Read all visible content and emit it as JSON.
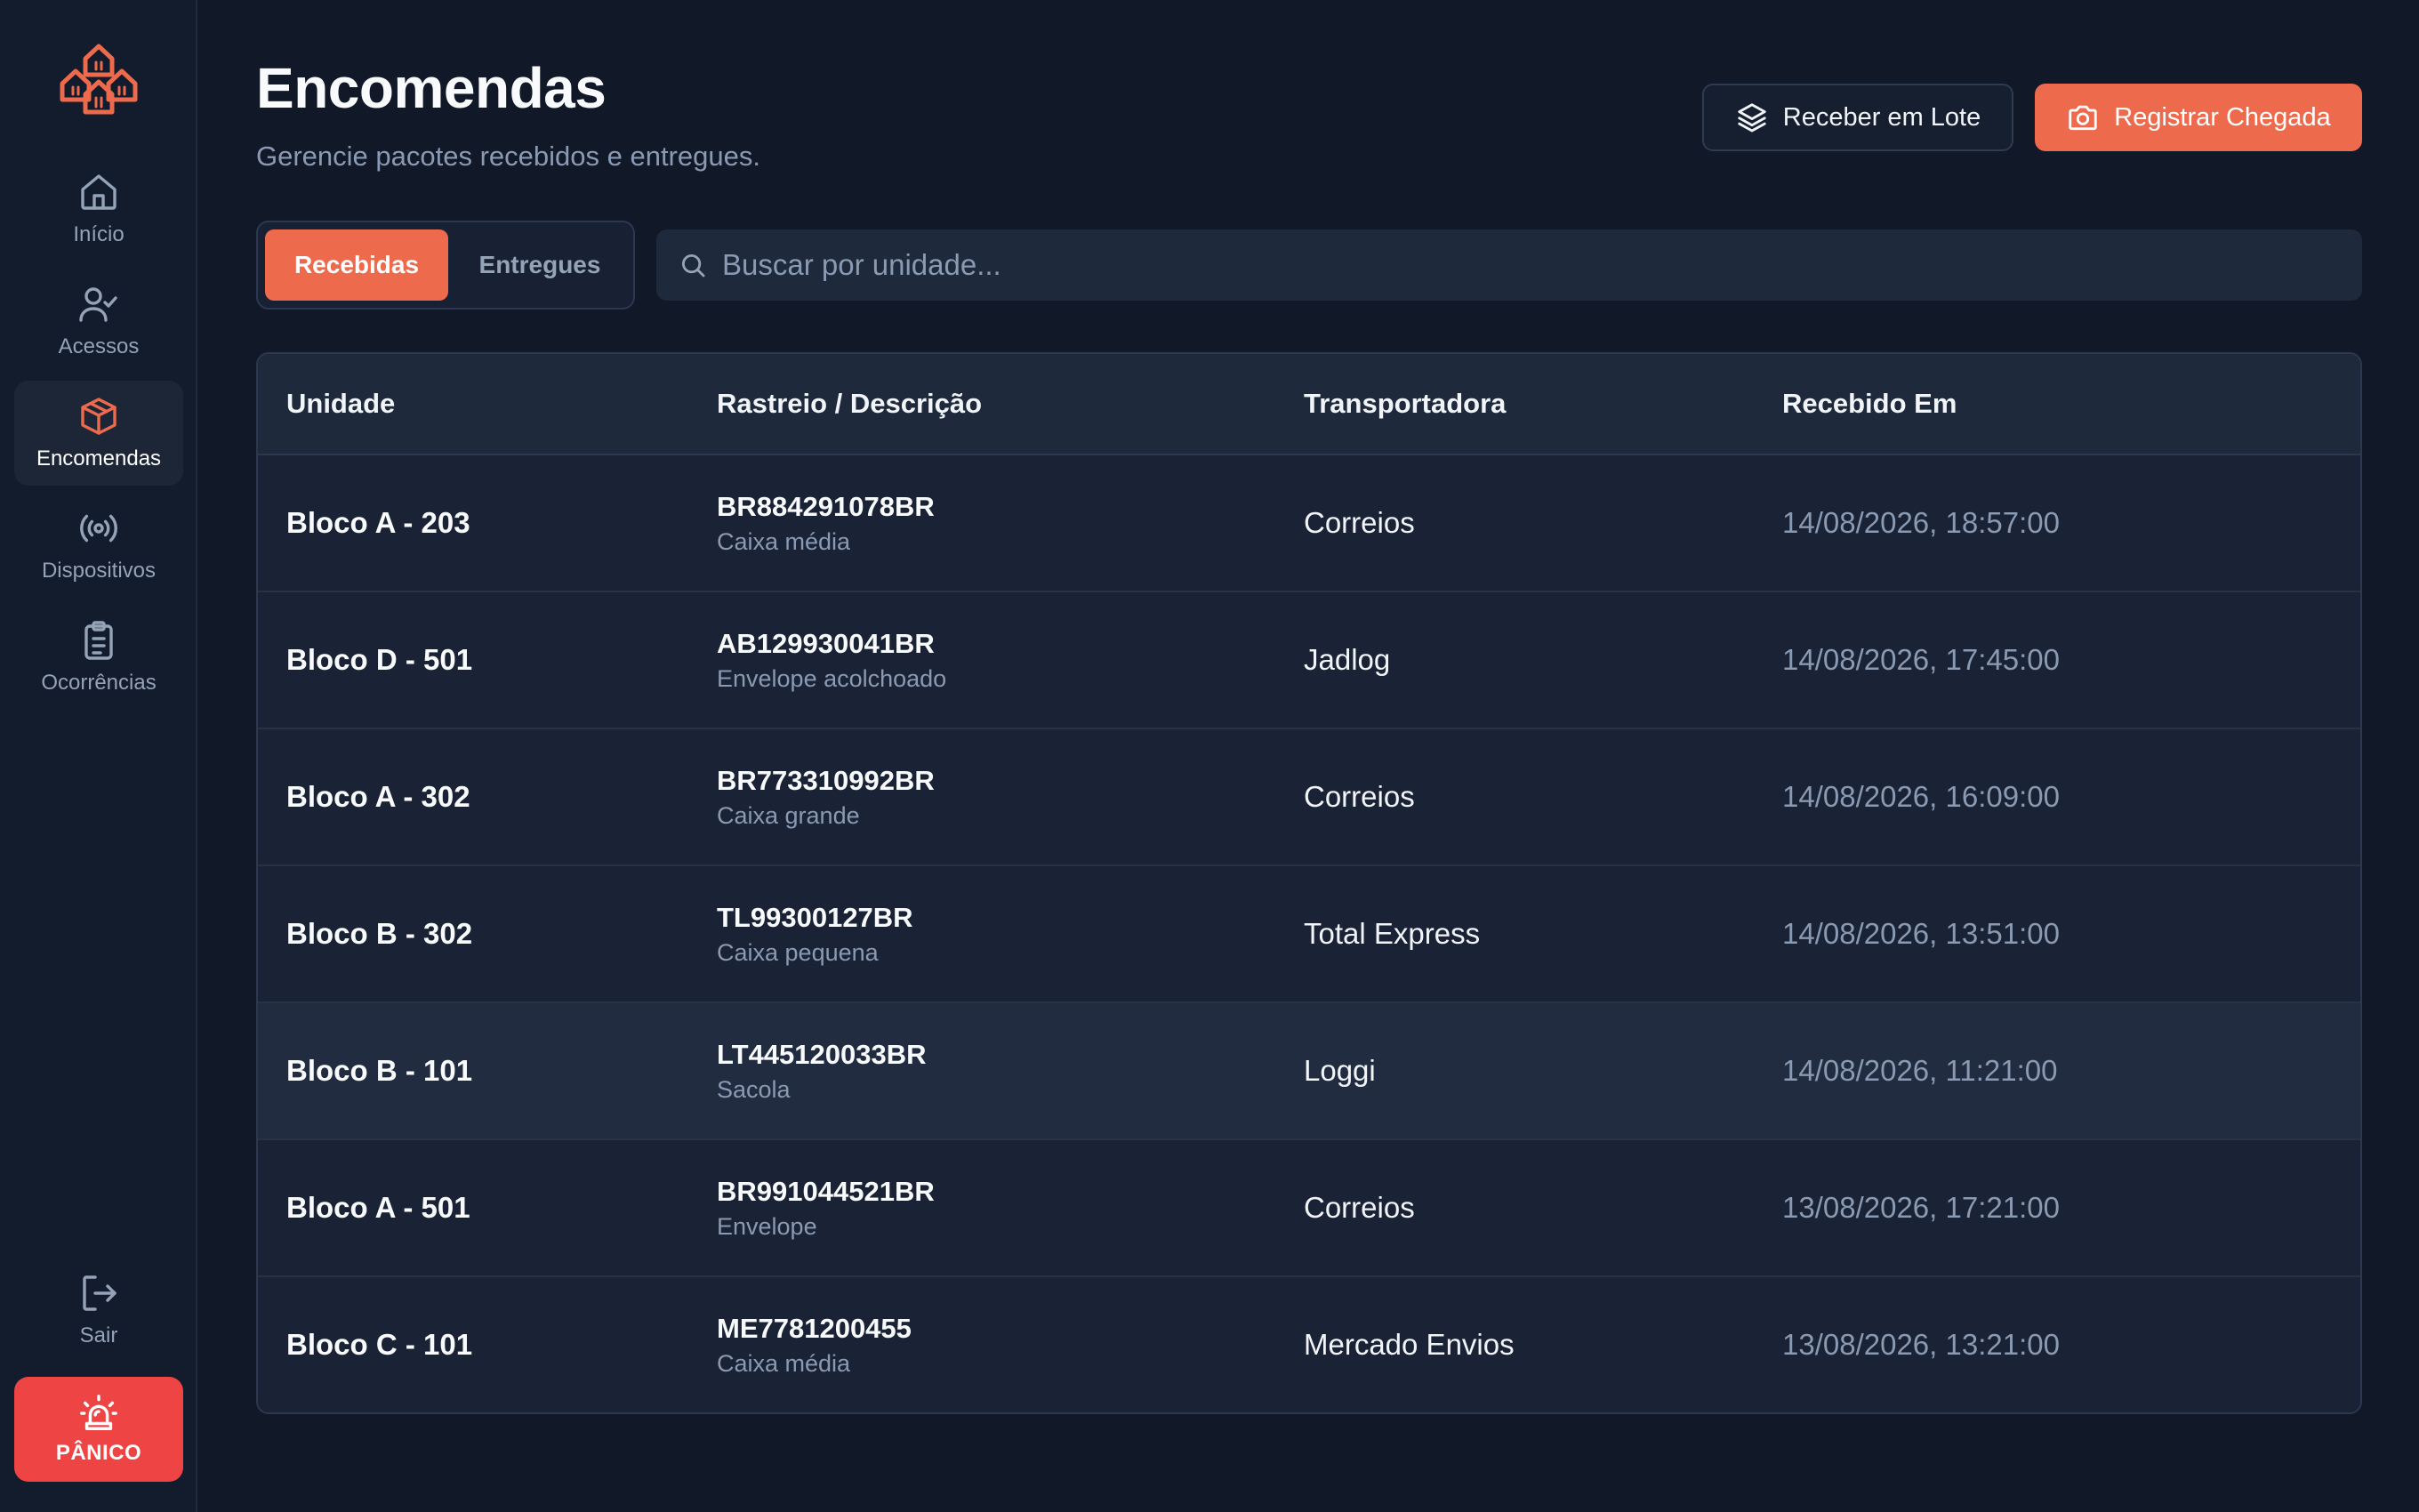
{
  "sidebar": {
    "logo": "buildings-logo",
    "items": [
      {
        "label": "Início",
        "icon": "home-icon"
      },
      {
        "label": "Acessos",
        "icon": "user-check-icon"
      },
      {
        "label": "Encomendas",
        "icon": "package-icon",
        "active": true
      },
      {
        "label": "Dispositivos",
        "icon": "radio-broadcast-icon"
      },
      {
        "label": "Ocorrências",
        "icon": "clipboard-list-icon"
      }
    ],
    "logout": {
      "label": "Sair",
      "icon": "logout-icon"
    },
    "panic": {
      "label": "PÂNICO",
      "icon": "siren-icon"
    }
  },
  "header": {
    "title": "Encomendas",
    "subtitle": "Gerencie pacotes recebidos e entregues.",
    "batch_button": "Receber em Lote",
    "register_button": "Registrar Chegada"
  },
  "tabs": {
    "received": "Recebidas",
    "delivered": "Entregues",
    "active": "received"
  },
  "search": {
    "placeholder": "Buscar por unidade...",
    "value": ""
  },
  "table": {
    "headers": {
      "unit": "Unidade",
      "tracking": "Rastreio / Descrição",
      "carrier": "Transportadora",
      "received_at": "Recebido Em"
    },
    "rows": [
      {
        "unit": "Bloco A - 203",
        "tracking": "BR884291078BR",
        "description": "Caixa média",
        "carrier": "Correios",
        "received_at": "14/08/2026, 18:57:00"
      },
      {
        "unit": "Bloco D - 501",
        "tracking": "AB129930041BR",
        "description": "Envelope acolchoado",
        "carrier": "Jadlog",
        "received_at": "14/08/2026, 17:45:00"
      },
      {
        "unit": "Bloco A - 302",
        "tracking": "BR773310992BR",
        "description": "Caixa grande",
        "carrier": "Correios",
        "received_at": "14/08/2026, 16:09:00"
      },
      {
        "unit": "Bloco B - 302",
        "tracking": "TL99300127BR",
        "description": "Caixa pequena",
        "carrier": "Total Express",
        "received_at": "14/08/2026, 13:51:00"
      },
      {
        "unit": "Bloco B - 101",
        "tracking": "LT445120033BR",
        "description": "Sacola",
        "carrier": "Loggi",
        "received_at": "14/08/2026, 11:21:00"
      },
      {
        "unit": "Bloco A - 501",
        "tracking": "BR991044521BR",
        "description": "Envelope",
        "carrier": "Correios",
        "received_at": "13/08/2026, 17:21:00"
      },
      {
        "unit": "Bloco C - 101",
        "tracking": "ME7781200455",
        "description": "Caixa média",
        "carrier": "Mercado Envios",
        "received_at": "13/08/2026, 13:21:00"
      }
    ]
  },
  "colors": {
    "accent": "#ee6a4c",
    "panic": "#ef4444",
    "background": "#111827",
    "sidebar": "#131c2c"
  }
}
